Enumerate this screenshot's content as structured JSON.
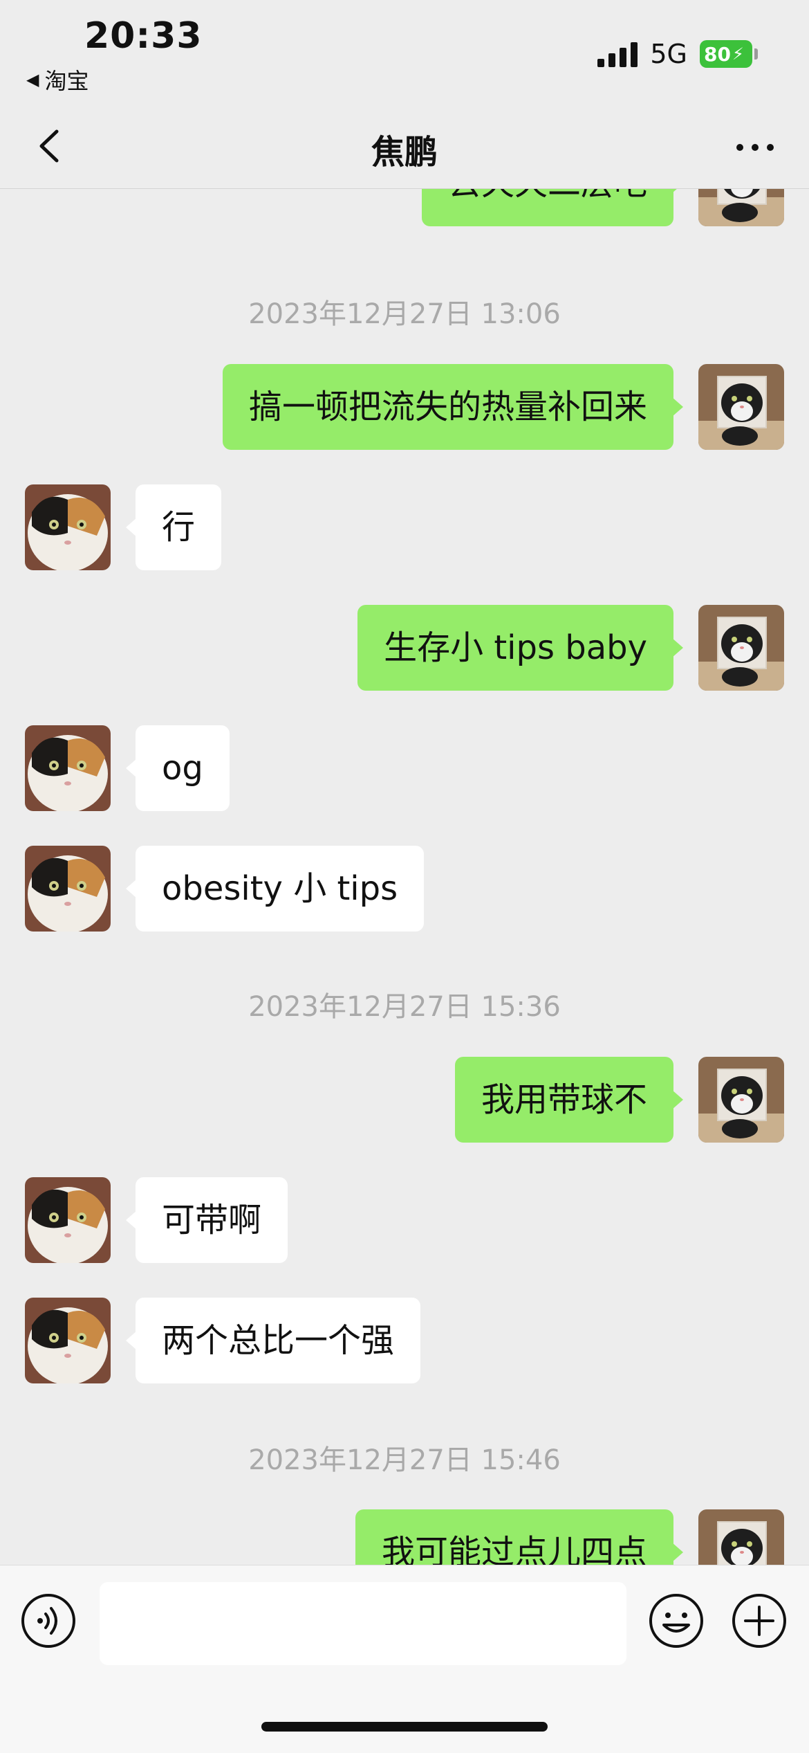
{
  "status_bar": {
    "time": "20:33",
    "back_app": "淘宝",
    "network": "5G",
    "battery": "80"
  },
  "nav": {
    "title": "焦鹏"
  },
  "messages": [
    {
      "type": "out",
      "text": "去天天二层吧"
    },
    {
      "type": "time",
      "text": "2023年12月27日 13:06"
    },
    {
      "type": "out",
      "text": "搞一顿把流失的热量补回来"
    },
    {
      "type": "in",
      "text": "行"
    },
    {
      "type": "out",
      "text": "生存小 tips baby"
    },
    {
      "type": "in",
      "text": "og"
    },
    {
      "type": "in",
      "text": "obesity 小 tips"
    },
    {
      "type": "time",
      "text": "2023年12月27日 15:36"
    },
    {
      "type": "out",
      "text": "我用带球不"
    },
    {
      "type": "in",
      "text": "可带啊"
    },
    {
      "type": "in",
      "text": "两个总比一个强"
    },
    {
      "type": "time",
      "text": "2023年12月27日 15:46"
    },
    {
      "type": "out",
      "text": "我可能过点儿四点"
    }
  ],
  "input": {
    "placeholder": ""
  },
  "colors": {
    "background": "#ededed",
    "outgoing_bubble": "#95ec69",
    "incoming_bubble": "#ffffff",
    "battery": "#3cc13b"
  },
  "icons": {
    "voice": "voice-icon",
    "emoji": "emoji-icon",
    "plus": "plus-icon",
    "back": "chevron-left-icon",
    "more": "more-icon"
  }
}
